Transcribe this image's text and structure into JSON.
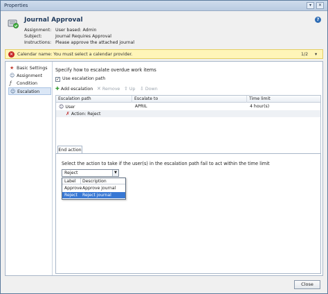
{
  "window": {
    "title": "Properties",
    "pin_glyph": "▾",
    "close_glyph": "✕"
  },
  "header": {
    "title": "Journal Approval",
    "assignment_label": "Assignment:",
    "assignment_value": "User based: Admin",
    "subject_label": "Subject:",
    "subject_value": "Journal Requires Approval",
    "instructions_label": "Instructions:",
    "instructions_value": "Please approve the attached journal",
    "help_glyph": "?"
  },
  "warning": {
    "text": "Calendar name: You must select a calendar provider.",
    "page": "1/2",
    "caret": "▾",
    "color": "#fff5b8"
  },
  "nav": {
    "items": [
      {
        "label": "Basic Settings",
        "icon": "star-icon"
      },
      {
        "label": "Assignment",
        "icon": "users-icon"
      },
      {
        "label": "Condition",
        "icon": "function-icon"
      },
      {
        "label": "Escalation",
        "icon": "escalation-icon"
      }
    ],
    "selected": "Escalation"
  },
  "escalation": {
    "instruction": "Specify how to escalate overdue work items",
    "use_path_label": "Use escalation path",
    "use_path_checked": true,
    "toolbar": {
      "add": "Add escalation",
      "remove": "Remove",
      "up": "Up",
      "down": "Down"
    },
    "columns": [
      "Escalation path",
      "Escalate to",
      "Time limit"
    ],
    "rows": [
      {
        "path": "User",
        "escalate_to": "APRIL",
        "time_limit": "4 hour(s)"
      },
      {
        "path": "Action: Reject",
        "escalate_to": "",
        "time_limit": ""
      }
    ]
  },
  "end_action": {
    "tab_label": "End action",
    "instruction": "Select the action to take if the user(s) in the escalation path fail to act within the time limit",
    "selected_value": "Reject",
    "dropdown": {
      "columns": [
        "Label",
        "Description"
      ],
      "options": [
        {
          "label": "Approve",
          "description": "Approve journal"
        },
        {
          "label": "Reject",
          "description": "Reject journal"
        }
      ],
      "highlighted": "Reject"
    }
  },
  "footer": {
    "close_label": "Close"
  },
  "colors": {
    "accent": "#3878d4",
    "title_text": "#1e395b",
    "error": "#c62828"
  }
}
